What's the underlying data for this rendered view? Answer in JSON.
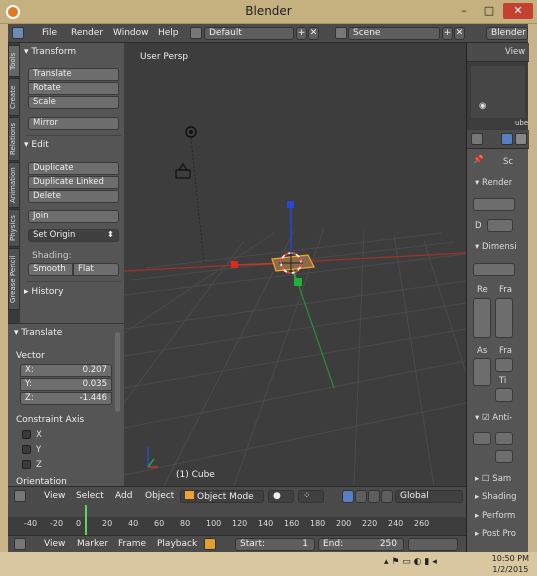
{
  "window": {
    "title": "Blender",
    "minimize": "–",
    "maximize": "□",
    "close": "✕"
  },
  "menubar": {
    "items": [
      "File",
      "Render",
      "Window",
      "Help"
    ],
    "screen_layout": "Default",
    "scene": "Scene",
    "render_engine": "Blender R"
  },
  "toolshelf": {
    "tabs": [
      "Tools",
      "Create",
      "Relations",
      "Animation",
      "Physics",
      "Grease Pencil"
    ],
    "transform_header": "Transform",
    "transform_buttons": [
      "Translate",
      "Rotate",
      "Scale"
    ],
    "mirror": "Mirror",
    "edit_header": "Edit",
    "edit_buttons": [
      "Duplicate",
      "Duplicate Linked",
      "Delete"
    ],
    "join": "Join",
    "set_origin": "Set Origin",
    "shading_label": "Shading:",
    "shading_smooth": "Smooth",
    "shading_flat": "Flat",
    "history_header": "History"
  },
  "operator": {
    "header": "Translate",
    "vector_label": "Vector",
    "x_label": "X:",
    "x_value": "0.207",
    "y_label": "Y:",
    "y_value": "0.035",
    "z_label": "Z:",
    "z_value": "-1.446",
    "constraint_label": "Constraint Axis",
    "axes": [
      "X",
      "Y",
      "Z"
    ],
    "orientation_label": "Orientation"
  },
  "viewport": {
    "perspective_label": "User Persp",
    "object_label": "(1) Cube"
  },
  "view_header": {
    "menus": [
      "View",
      "Select",
      "Add",
      "Object"
    ],
    "mode": "Object Mode",
    "orientation": "Global"
  },
  "timeline": {
    "ticks": [
      "-40",
      "-20",
      "0",
      "20",
      "40",
      "60",
      "80",
      "100",
      "120",
      "140",
      "160",
      "180",
      "200",
      "220",
      "240",
      "260"
    ]
  },
  "timeline_header": {
    "menus": [
      "View",
      "Marker",
      "Frame",
      "Playback"
    ],
    "start_label": "Start:",
    "start_value": "1",
    "end_label": "End:",
    "end_value": "250"
  },
  "outliner": {
    "view_label": "View",
    "cube_label": "ube"
  },
  "properties": {
    "scene_label": "Sc",
    "render_header": "Render",
    "d_label": "D",
    "dimensions_header": "Dimensi",
    "re_label": "Re",
    "fra_label": "Fra",
    "as_label": "As",
    "fra2_label": "Fra",
    "ti_label": "Ti",
    "anti_label": "Anti-",
    "sampling_header": "Sam",
    "shading_header": "Shading",
    "performance_header": "Perform",
    "postpro_header": "Post Pro"
  },
  "taskbar": {
    "time": "10:50 PM",
    "date": "1/2/2015"
  },
  "colors": {
    "viewport_bg": "#3d3d3d",
    "grid": "#4a4a4a",
    "x_axis": "#c0392b",
    "y_axis": "#2ea043",
    "z_axis": "#2747d6",
    "selection": "#f5a623",
    "current_frame": "#5cd65c"
  }
}
